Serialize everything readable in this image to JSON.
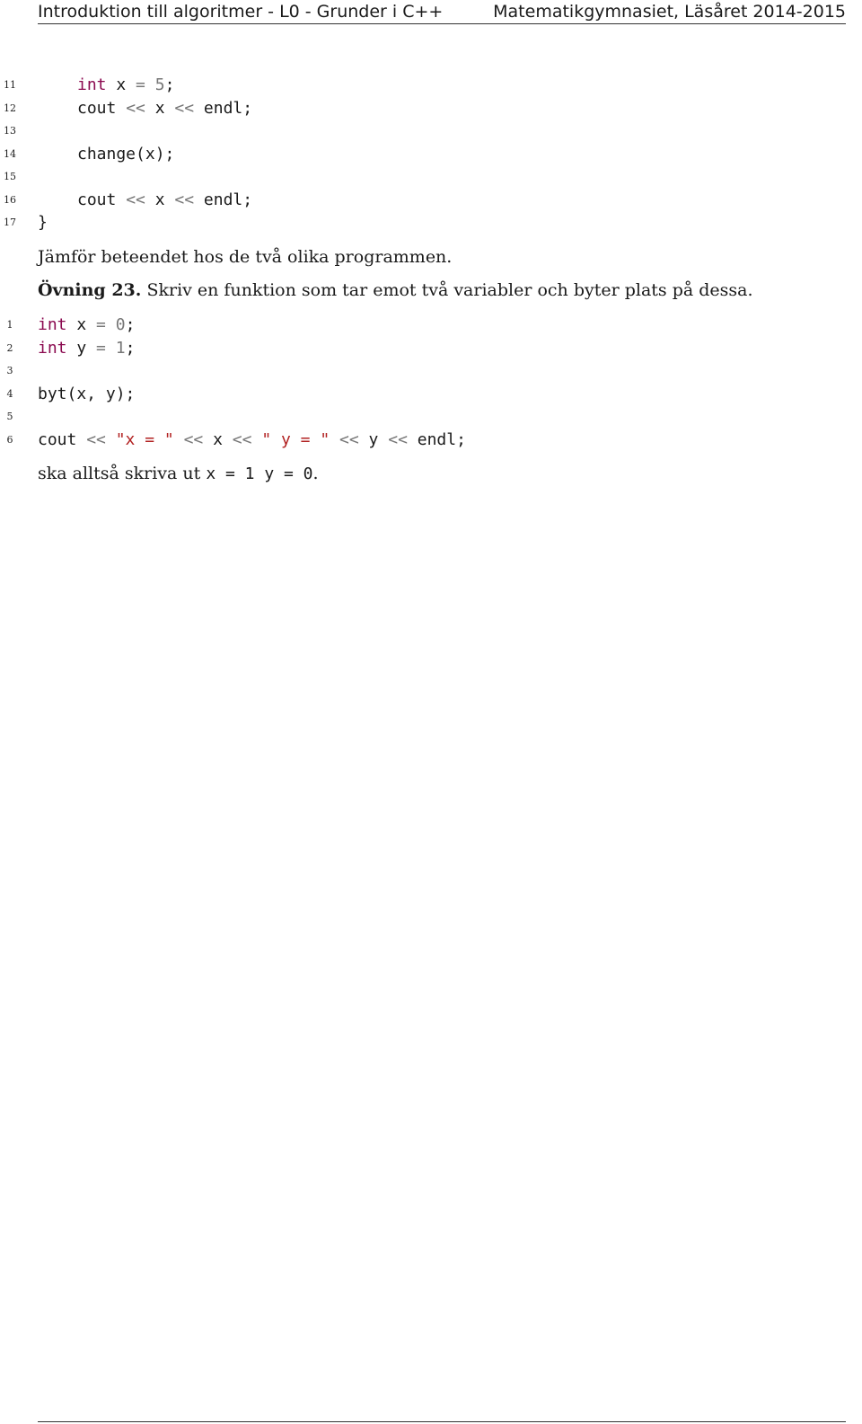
{
  "header": {
    "left": "Introduktion till algoritmer - L0 - Grunder i C++",
    "right": "Matematikgymnasiet, Läsåret 2014-2015"
  },
  "listing1": [
    {
      "n": "11",
      "indent": 2,
      "parts": [
        [
          "kw",
          "int"
        ],
        [
          "",
          ""
        ],
        [
          "plain",
          " x "
        ],
        [
          "op",
          "="
        ],
        [
          "plain",
          " "
        ],
        [
          "num",
          "5"
        ],
        [
          "plain",
          ";"
        ]
      ]
    },
    {
      "n": "12",
      "indent": 2,
      "parts": [
        [
          "plain",
          "cout "
        ],
        [
          "op",
          "<<"
        ],
        [
          "plain",
          " x "
        ],
        [
          "op",
          "<<"
        ],
        [
          "plain",
          " endl;"
        ]
      ]
    },
    {
      "n": "13",
      "indent": 2,
      "parts": []
    },
    {
      "n": "14",
      "indent": 2,
      "parts": [
        [
          "plain",
          "change(x);"
        ]
      ]
    },
    {
      "n": "15",
      "indent": 2,
      "parts": []
    },
    {
      "n": "16",
      "indent": 2,
      "parts": [
        [
          "plain",
          "cout "
        ],
        [
          "op",
          "<<"
        ],
        [
          "plain",
          " x "
        ],
        [
          "op",
          "<<"
        ],
        [
          "plain",
          " endl;"
        ]
      ]
    },
    {
      "n": "17",
      "indent": 0,
      "parts": [
        [
          "plain",
          "}"
        ]
      ]
    }
  ],
  "compare_text": "Jämför beteendet hos de två olika programmen.",
  "exercise": {
    "label": "Övning 23.",
    "text": "Skriv en funktion som tar emot två variabler och byter plats på dessa."
  },
  "listing2": [
    {
      "n": "1",
      "indent": 0,
      "parts": [
        [
          "kw",
          "int"
        ],
        [
          "plain",
          " x "
        ],
        [
          "op",
          "="
        ],
        [
          "plain",
          " "
        ],
        [
          "num",
          "0"
        ],
        [
          "plain",
          ";"
        ]
      ]
    },
    {
      "n": "2",
      "indent": 0,
      "parts": [
        [
          "kw",
          "int"
        ],
        [
          "plain",
          " y "
        ],
        [
          "op",
          "="
        ],
        [
          "plain",
          " "
        ],
        [
          "num",
          "1"
        ],
        [
          "plain",
          ";"
        ]
      ]
    },
    {
      "n": "3",
      "indent": 0,
      "parts": []
    },
    {
      "n": "4",
      "indent": 0,
      "parts": [
        [
          "plain",
          "byt(x, y);"
        ]
      ]
    },
    {
      "n": "5",
      "indent": 0,
      "parts": []
    },
    {
      "n": "6",
      "indent": 0,
      "parts": [
        [
          "plain",
          "cout "
        ],
        [
          "op",
          "<<"
        ],
        [
          "plain",
          " "
        ],
        [
          "str",
          "\"x = \""
        ],
        [
          "plain",
          " "
        ],
        [
          "op",
          "<<"
        ],
        [
          "plain",
          " x "
        ],
        [
          "op",
          "<<"
        ],
        [
          "plain",
          " "
        ],
        [
          "str",
          "\" y = \""
        ],
        [
          "plain",
          " "
        ],
        [
          "op",
          "<<"
        ],
        [
          "plain",
          " y "
        ],
        [
          "op",
          "<<"
        ],
        [
          "plain",
          " endl;"
        ]
      ]
    }
  ],
  "result": {
    "prefix": "ska alltså skriva ut ",
    "code": "x = 1 y = 0",
    "suffix": "."
  }
}
